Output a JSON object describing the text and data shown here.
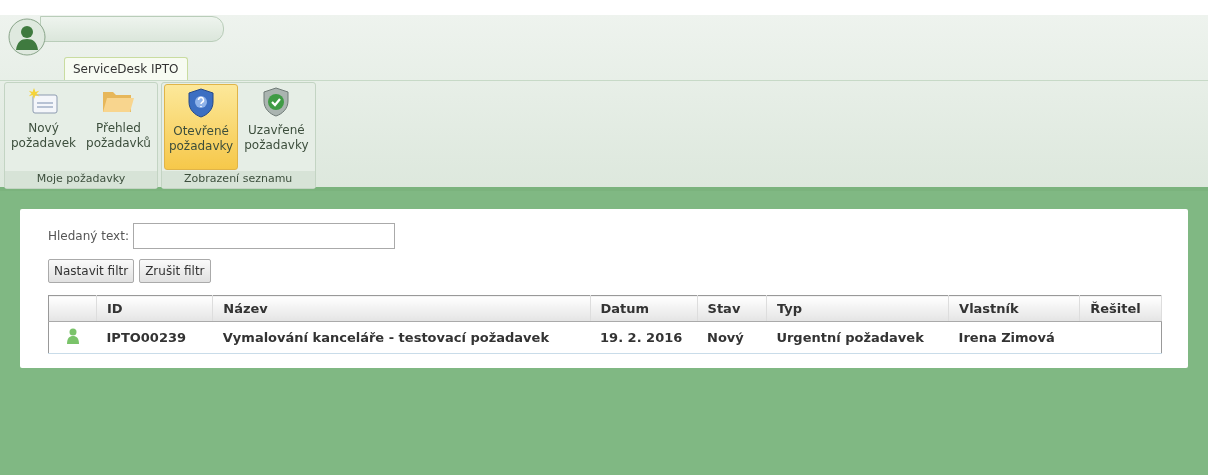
{
  "ribbon": {
    "tab": {
      "label": "ServiceDesk IPTO",
      "selected": true
    },
    "groups": [
      {
        "label": "Moje požadavky",
        "buttons": [
          {
            "kind": "new",
            "line1": "Nový",
            "line2": "požadavek",
            "selected": false
          },
          {
            "kind": "folder",
            "line1": "Přehled",
            "line2": "požadavků",
            "selected": false
          }
        ]
      },
      {
        "label": "Zobrazení seznamu",
        "buttons": [
          {
            "kind": "open",
            "line1": "Otevřené",
            "line2": "požadavky",
            "selected": true
          },
          {
            "kind": "closed",
            "line1": "Uzavřené",
            "line2": "požadavky",
            "selected": false
          }
        ]
      }
    ]
  },
  "search": {
    "label": "Hledaný text:"
  },
  "filter_buttons": [
    "Nastavit filtr",
    "Zrušit filtr"
  ],
  "table": {
    "columns": [
      "ID",
      "Název",
      "Datum",
      "Stav",
      "Typ",
      "Vlastník",
      "Řešitel"
    ],
    "rows": [
      {
        "cells": [
          "IPTO00239",
          "Vymalování kanceláře - testovací požadavek",
          "19. 2. 2016",
          "Nový",
          "Urgentní požadavek",
          "Irena Zimová"
        ]
      }
    ]
  }
}
